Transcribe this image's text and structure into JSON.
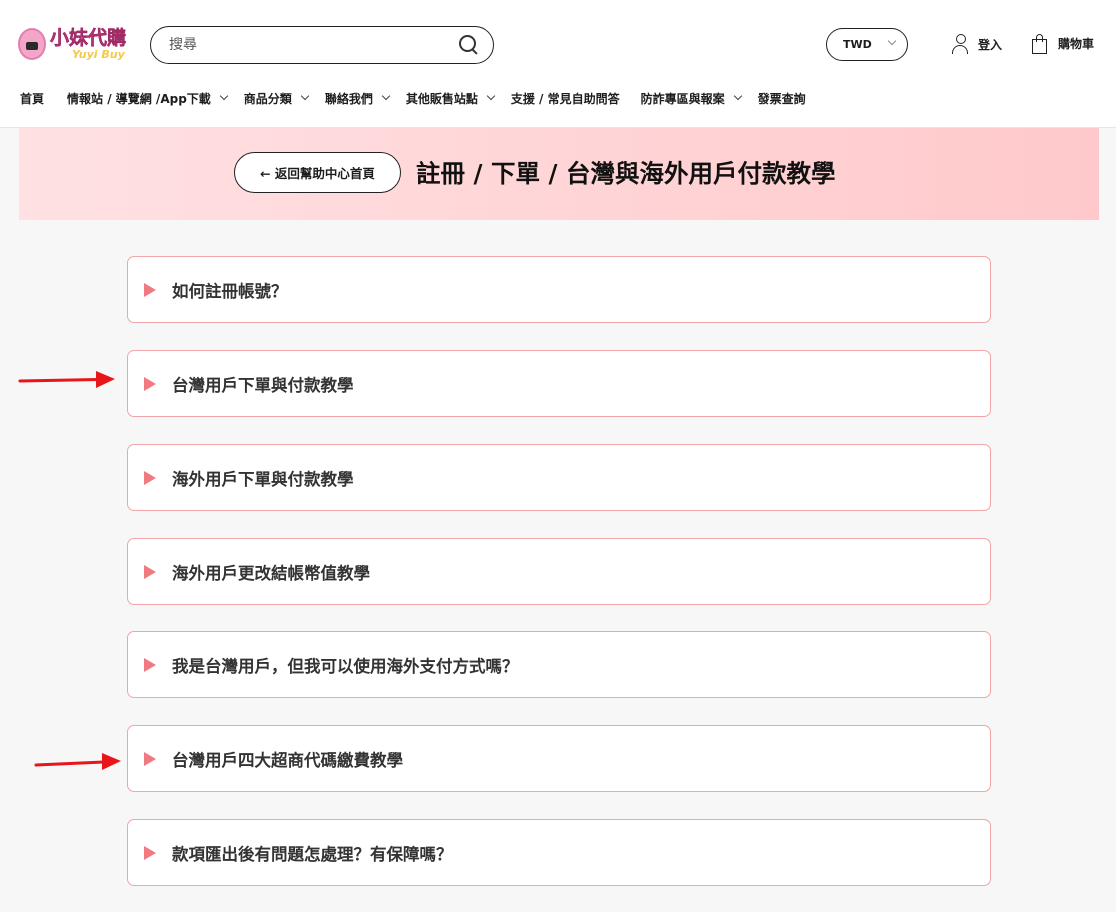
{
  "brand": {
    "logo_main": "小妹代購",
    "logo_sub": "Yuyi Buy"
  },
  "search": {
    "placeholder": "搜尋"
  },
  "currency": {
    "value": "TWD"
  },
  "account": {
    "login_label": "登入",
    "cart_label": "購物車"
  },
  "nav": [
    {
      "label": "首頁",
      "has_dropdown": false
    },
    {
      "label": "情報站 / 導覽網 /App下載",
      "has_dropdown": true
    },
    {
      "label": "商品分類",
      "has_dropdown": true
    },
    {
      "label": "聯絡我們",
      "has_dropdown": true
    },
    {
      "label": "其他販售站點",
      "has_dropdown": true
    },
    {
      "label": "支援 / 常見自助問答",
      "has_dropdown": false
    },
    {
      "label": "防詐專區與報案",
      "has_dropdown": true
    },
    {
      "label": "發票查詢",
      "has_dropdown": false
    }
  ],
  "banner": {
    "back_label": "← 返回幫助中心首頁",
    "title": "註冊 / 下單 / 台灣與海外用戶付款教學"
  },
  "faq": [
    {
      "label": "如何註冊帳號？",
      "highlighted": false
    },
    {
      "label": "台灣用戶下單與付款教學",
      "highlighted": true
    },
    {
      "label": "海外用戶下單與付款教學",
      "highlighted": false
    },
    {
      "label": "海外用戶更改結帳幣值教學",
      "highlighted": false
    },
    {
      "label": "我是台灣用戶，但我可以使用海外支付方式嗎？",
      "highlighted": false
    },
    {
      "label": "台灣用戶四大超商代碼繳費教學",
      "highlighted": true
    },
    {
      "label": "款項匯出後有問題怎處理？有保障嗎？",
      "highlighted": false
    }
  ],
  "colors": {
    "accent_border": "#f1a5a7",
    "triangle": "#f07a7f",
    "annotation_arrow": "#e8151b",
    "banner_start": "#ffe1e3",
    "banner_end": "#ffc9cb"
  }
}
